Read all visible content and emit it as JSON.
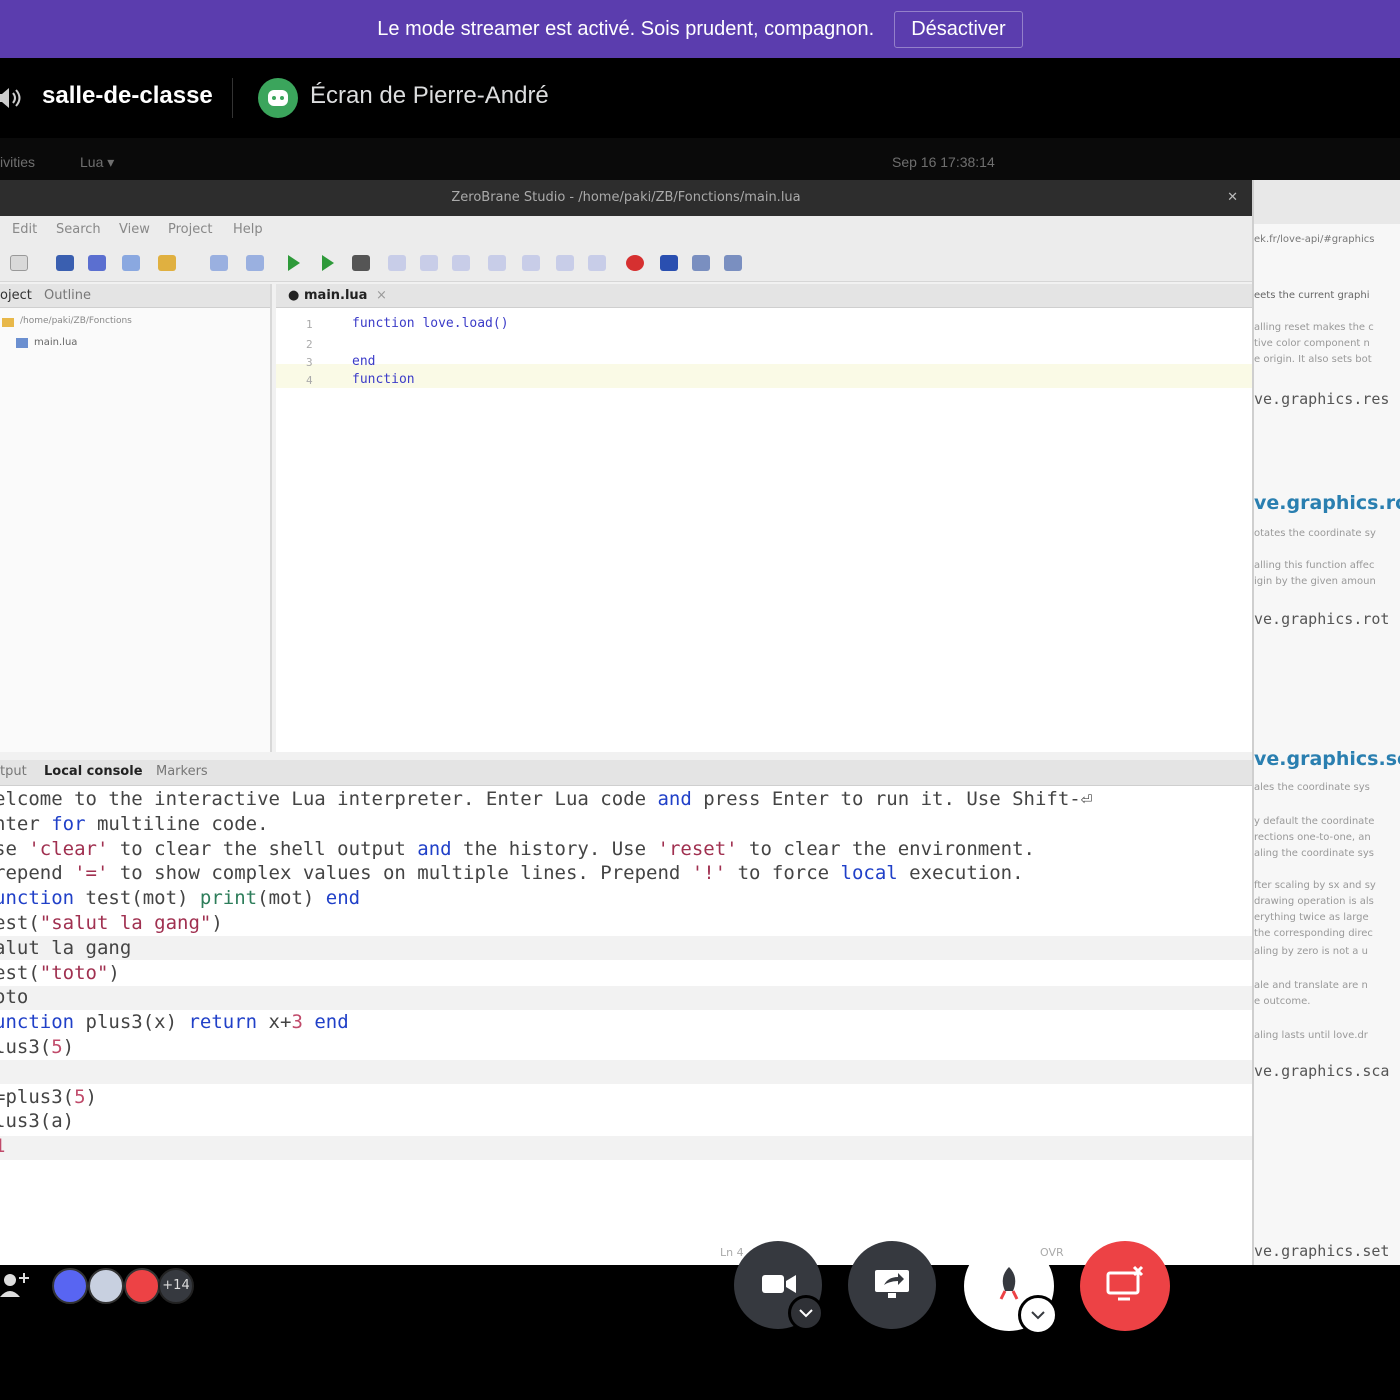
{
  "banner": {
    "message": "Le mode streamer est activé. Sois prudent, compagnon.",
    "button": "Désactiver"
  },
  "call": {
    "channel": "salle-de-classe",
    "screen_title": "Écran de Pierre-André"
  },
  "desktop": {
    "activities": "ivities",
    "lang": "Lua ▾",
    "clock": "Sep 16 17:38:14"
  },
  "ide": {
    "window_title": "ZeroBrane Studio - /home/paki/ZB/Fonctions/main.lua",
    "menu": [
      "Edit",
      "Search",
      "View",
      "Project",
      "Help"
    ],
    "project_tabs": [
      "oject",
      "Outline"
    ],
    "project_tree": {
      "folder": "/home/paki/ZB/Fonctions",
      "file": "main.lua"
    },
    "editor_tab": "main.lua",
    "editor_lines": [
      {
        "n": "1",
        "code": "function love.load()"
      },
      {
        "n": "2",
        "code": ""
      },
      {
        "n": "3",
        "code": "end"
      },
      {
        "n": "4",
        "code": "function"
      }
    ],
    "console_tabs": [
      "tput",
      "Local console",
      "Markers"
    ],
    "console_lines": [
      "elcome to the interactive Lua interpreter. Enter Lua code and press Enter to run it. Use Shift-⏎",
      "nter for multiline code.",
      "se 'clear' to clear the shell output and the history. Use 'reset' to clear the environment.",
      "repend '=' to show complex values on multiple lines. Prepend '!' to force local execution.",
      "unction test(mot) print(mot) end",
      "est(\"salut la gang\")",
      "alut la gang",
      "est(\"toto\")",
      "oto",
      "unction plus3(x) return x+3 end",
      "lus3(5)",
      "",
      "=plus3(5)",
      "lus3(a)",
      "1"
    ],
    "status_fragments": [
      "Ln 4",
      "OVR"
    ]
  },
  "docs": {
    "path": "ek.fr/love-api/#graphics",
    "heading_1": "ve.graphics.rot",
    "heading_2": "ve.graphics.sca",
    "code_1": "ve.graphics.res",
    "code_2": "ve.graphics.rot",
    "code_3": "ve.graphics.sca",
    "code_4": "ve.graphics.set",
    "text_1": "eets the current graphi",
    "text_2": "alling reset makes the c",
    "text_3": "tive color component n",
    "text_4": "e origin. It also sets bot",
    "text_5": "otates the coordinate sy",
    "text_6": "alling this function affec",
    "text_7": "igin by the given amoun",
    "text_8": "ales the coordinate sys",
    "text_9": "y default the coordinate",
    "text_10": "rections one-to-one, an",
    "text_11": "aling the coordinate sys",
    "text_12": "fter scaling by sx and sy",
    "text_13": "drawing operation is als",
    "text_14": "erything twice as large",
    "text_15": "the corresponding direc",
    "text_16": "aling by zero is not a u",
    "text_17": "ale and translate are n",
    "text_18": "e outcome.",
    "text_19": "aling lasts until love.dr"
  },
  "bottom": {
    "participants_more": "+14"
  },
  "colors": {
    "banner": "#5b3dae",
    "disconnect": "#ed4245",
    "discord_green": "#3ba55c"
  }
}
